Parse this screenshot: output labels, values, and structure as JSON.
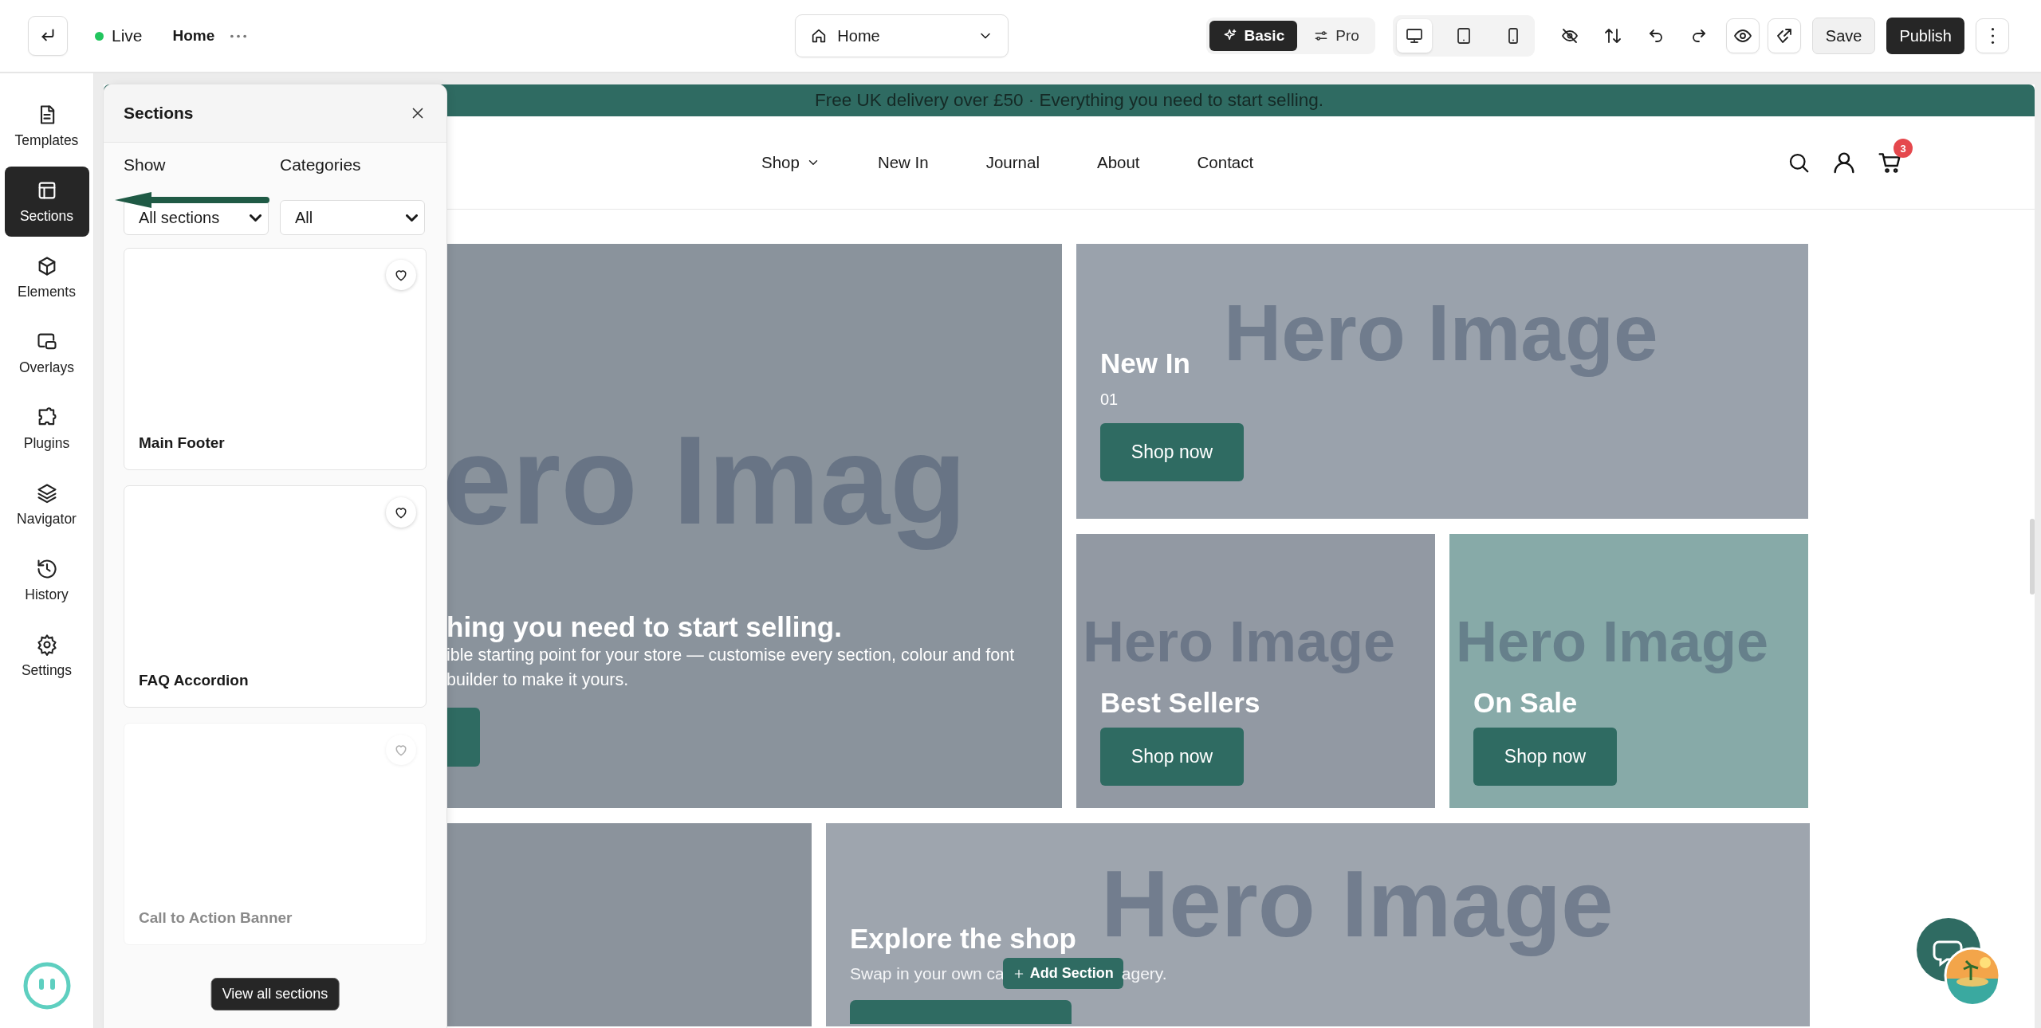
{
  "topbar": {
    "status": {
      "label": "Live",
      "color": "#22c55e"
    },
    "page": "Home",
    "page_select": "Home",
    "modes": [
      {
        "label": "Basic",
        "kind": "sparkle",
        "selected": true
      },
      {
        "label": "Pro",
        "kind": "sliders",
        "selected": false
      }
    ],
    "devices": [
      {
        "kind": "desktop",
        "selected": true
      },
      {
        "kind": "tablet",
        "selected": false
      },
      {
        "kind": "mobile",
        "selected": false
      }
    ],
    "save": "Save",
    "publish": "Publish"
  },
  "rail": [
    {
      "label": "Templates",
      "kind": "document",
      "selected": false
    },
    {
      "label": "Sections",
      "kind": "layout",
      "selected": true
    },
    {
      "label": "Elements",
      "kind": "cube",
      "selected": false
    },
    {
      "label": "Overlays",
      "kind": "overlays",
      "selected": false
    },
    {
      "label": "Plugins",
      "kind": "puzzle",
      "selected": false
    },
    {
      "label": "Navigator",
      "kind": "layers",
      "selected": false
    },
    {
      "label": "History",
      "kind": "history",
      "selected": false
    },
    {
      "label": "Settings",
      "kind": "gear",
      "selected": false
    }
  ],
  "panel": {
    "title": "Sections",
    "filters": [
      {
        "label": "Show",
        "value": "All sections"
      },
      {
        "label": "Categories",
        "value": "All"
      }
    ],
    "cards": [
      {
        "name": "Main Footer",
        "faded": false
      },
      {
        "name": "FAQ Accordion",
        "faded": false
      },
      {
        "name": "Call to Action Banner",
        "faded": true
      }
    ],
    "view_all": "View all sections"
  },
  "site": {
    "banner": "Free UK delivery over £50 · Everything you need to start selling.",
    "nav": [
      {
        "label": "Shop",
        "dropdown": true
      },
      {
        "label": "New In",
        "dropdown": false
      },
      {
        "label": "Journal",
        "dropdown": false
      },
      {
        "label": "About",
        "dropdown": false
      },
      {
        "label": "Contact",
        "dropdown": false
      }
    ],
    "cart_count": "3",
    "tiles": [
      {
        "kind": "feature",
        "color": "#8a939c",
        "placeholder": "ero Imag",
        "title": "hing you need to start selling.",
        "lines": [
          "ible starting point for your store — customise every section, colour and font",
          "builder to make it yours."
        ]
      },
      {
        "kind": "top",
        "color": "#9aa2ac",
        "placeholder": "Hero Image",
        "title": "New In",
        "subtitle": "01",
        "button": "Shop now"
      },
      {
        "kind": "bottom",
        "color": "#9299a3",
        "placeholder": "Hero Image",
        "title": "Best Sellers",
        "button": "Shop now"
      },
      {
        "kind": "bottom",
        "color": "#87aaa8",
        "placeholder": "Hero Image",
        "title": "On Sale",
        "button": "Shop now"
      }
    ],
    "bottom_tiles": [
      {
        "kind": "plain",
        "color": "#8b939c"
      },
      {
        "kind": "explore",
        "color": "#9ea5ae",
        "placeholder": "Hero Image",
        "title": "Explore the shop",
        "text_before": "Swap in your own ca",
        "text_after": "agery."
      }
    ],
    "add_section": "Add Section"
  }
}
